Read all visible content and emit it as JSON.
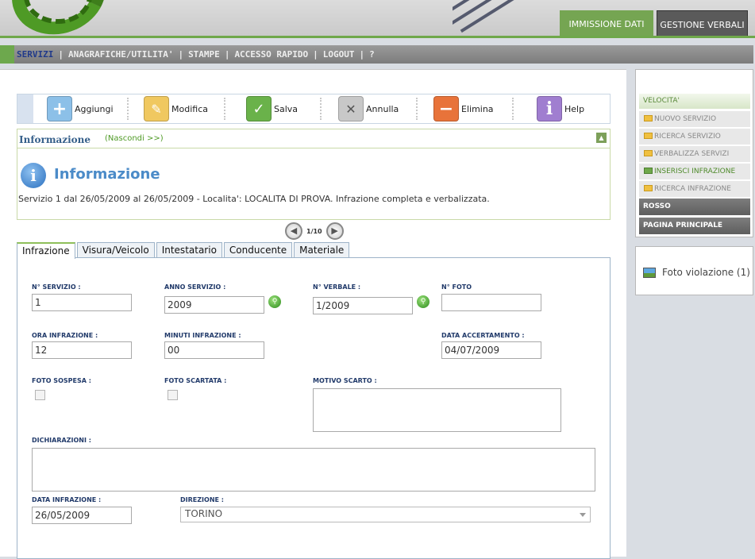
{
  "header": {
    "tabs": [
      {
        "label": "IMMISSIONE DATI"
      },
      {
        "label": "GESTIONE VERBALI"
      }
    ]
  },
  "nav": {
    "items": [
      "SERVIZI",
      "ANAGRAFICHE/UTILITA'",
      "STAMPE",
      "ACCESSO RAPIDO",
      "LOGOUT",
      "?"
    ],
    "active": "SERVIZI"
  },
  "toolbar": {
    "add": "Aggiungi",
    "edit": "Modifica",
    "save": "Salva",
    "cancel": "Annulla",
    "delete": "Elimina",
    "help": "Help"
  },
  "info": {
    "section_title": "Informazione",
    "toggle": "(Nascondi >>)",
    "title": "Informazione",
    "message": "Servizio 1 dal 26/05/2009 al 26/05/2009 - Localita': LOCALITA DI PROVA. Infrazione completa e verbalizzata."
  },
  "pager": {
    "text": "1/10"
  },
  "tabs": [
    "Infrazione",
    "Visura/Veicolo",
    "Intestatario",
    "Conducente",
    "Materiale"
  ],
  "form": {
    "n_servizio": {
      "label": "N° SERVIZIO :",
      "value": "1"
    },
    "anno_servizio": {
      "label": "ANNO SERVIZIO :",
      "value": "2009"
    },
    "n_verbale": {
      "label": "N° VERBALE :",
      "value": "1/2009"
    },
    "n_foto": {
      "label": "N° FOTO",
      "value": ""
    },
    "ora_infrazione": {
      "label": "ORA INFRAZIONE :",
      "value": "12"
    },
    "minuti_infrazione": {
      "label": "MINUTI INFRAZIONE :",
      "value": "00"
    },
    "data_accertamento": {
      "label": "DATA ACCERTAMENTO :",
      "value": "04/07/2009"
    },
    "foto_sospesa": {
      "label": "FOTO SOSPESA :"
    },
    "foto_scartata": {
      "label": "FOTO SCARTATA :"
    },
    "motivo_scarto": {
      "label": "MOTIVO SCARTO :"
    },
    "dichiarazioni": {
      "label": "DICHIARAZIONI :"
    },
    "data_infrazione": {
      "label": "DATA INFRAZIONE :",
      "value": "26/05/2009"
    },
    "direzione": {
      "label": "DIREZIONE :",
      "value": "TORINO"
    }
  },
  "sidebar": {
    "heading": "VELOCITA'",
    "items": [
      "NUOVO SERVIZIO",
      "RICERCA SERVIZIO",
      "VERBALIZZA SERVIZI",
      "INSERISCI INFRAZIONE",
      "RICERCA INFRAZIONE"
    ],
    "active_item": "INSERISCI INFRAZIONE",
    "dark_items": [
      "ROSSO",
      "PAGINA PRINCIPALE"
    ],
    "photo_link": "Foto violazione (1)"
  },
  "colors": {
    "accent_green": "#75a552",
    "dark_tab": "#5a5a5a",
    "label_blue": "#213a6a",
    "info_blue": "#4b8bc8"
  }
}
